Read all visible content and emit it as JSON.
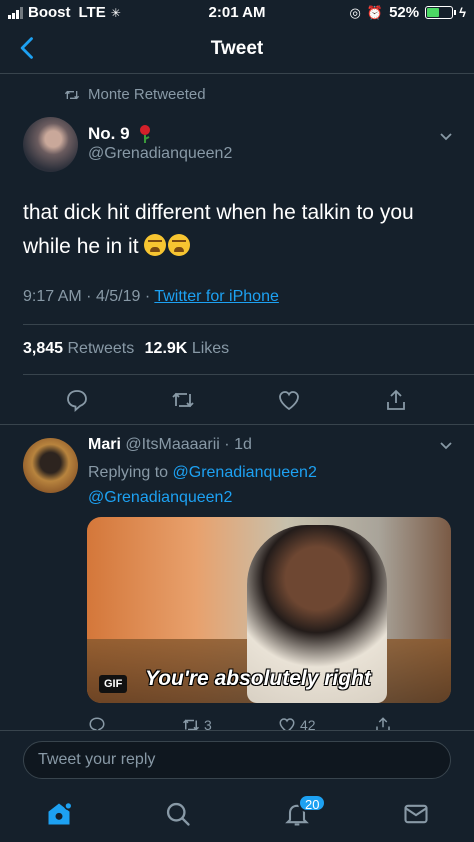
{
  "status_bar": {
    "carrier": "Boost",
    "network": "LTE",
    "time": "2:01 AM",
    "battery_percent": "52%",
    "battery_level": 0.52
  },
  "header": {
    "title": "Tweet"
  },
  "retweet_context": {
    "label": "Monte Retweeted"
  },
  "tweet": {
    "author_name": "No. 9",
    "author_handle": "@Grenadianqueen2",
    "text_line1": "that dick hit different when he talkin to you",
    "text_line2": "while he in it",
    "time": "9:17 AM",
    "date": "4/5/19",
    "source": "Twitter for iPhone",
    "retweets_count": "3,845",
    "retweets_label": "Retweets",
    "likes_count": "12.9K",
    "likes_label": "Likes"
  },
  "reply": {
    "author_name": "Mari",
    "author_handle": "@ItsMaaaarii",
    "age": "1d",
    "replying_label": "Replying to",
    "replying_to_1": "@Grenadianqueen2",
    "replying_to_2": "@Grenadianqueen2",
    "gif_badge": "GIF",
    "gif_caption": "You're absolutely right",
    "retweets": "3",
    "likes": "42"
  },
  "composer": {
    "placeholder": "Tweet your reply"
  },
  "tabbar": {
    "notifications_badge": "20"
  },
  "colors": {
    "background": "#15202b",
    "accent": "#1da1f2",
    "muted": "#8899a6",
    "divider": "#38444d",
    "battery_green": "#4cd964"
  }
}
